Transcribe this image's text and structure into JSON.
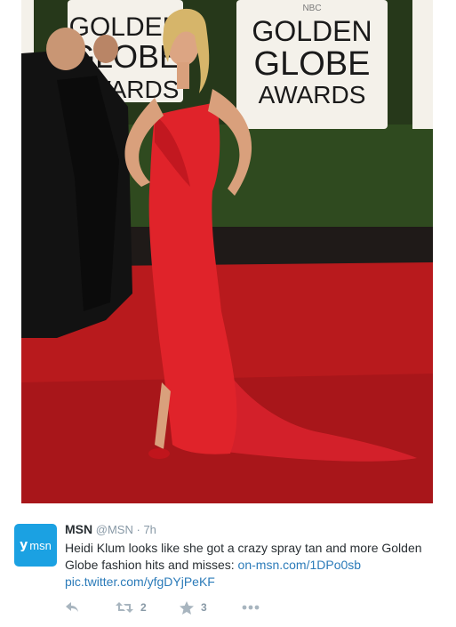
{
  "photo": {
    "alt": "Heidi Klum red gown Golden Globe Awards",
    "sign_left": [
      "GOLDEN",
      "GLOBE",
      "AWARDS"
    ],
    "sign_right": [
      "GOLDEN",
      "GLOBE",
      "AWARDS"
    ],
    "sign_logo": "NBC",
    "colors": {
      "carpet": "#b81a1d",
      "gown": "#e0232a",
      "hedge": "#2f4a1f",
      "sign": "#f4f1ea"
    }
  },
  "tweet": {
    "avatar": {
      "mark": "y",
      "brand": "msn",
      "color": "#1ba1e2",
      "icon": "msn-logo"
    },
    "display_name": "MSN",
    "handle": "@MSN",
    "separator": "·",
    "timestamp": "7h",
    "text_prefix": "Heidi Klum looks like she got a crazy spray tan and more Golden Globe fashion hits and misses: ",
    "link_1": "on-msn.com/1DPo0sb",
    "link_2": "pic.twitter.com/yfgDYjPeKF",
    "actions": {
      "reply_icon": "reply-icon",
      "retweet_icon": "retweet-icon",
      "retweet_count": "2",
      "favorite_icon": "star-icon",
      "favorite_count": "3",
      "more_icon": "more-icon"
    }
  }
}
